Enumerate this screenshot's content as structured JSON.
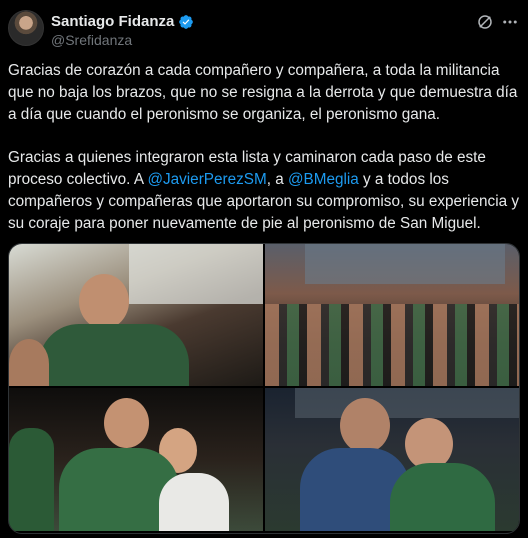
{
  "author": {
    "name": "Santiago Fidanza",
    "handle": "@Srefidanza"
  },
  "tweet": {
    "paragraph1": "Gracias de corazón a cada compañero y compañera, a toda la militancia que no baja los brazos, que no se resigna a la derrota y que demuestra día a día que cuando el peronismo se organiza, el peronismo gana.",
    "p2_a": "Gracias a quienes integraron esta lista y caminaron cada paso de este proceso colectivo. A ",
    "mention1": "@JavierPerezSM",
    "p2_b": ", a ",
    "mention2": "@BMeglia",
    "p2_c": " y a todos los compañeros y compañeras que aportaron su compromiso, su experiencia y su coraje para poner nuevamente de pie al peronismo de San Miguel."
  },
  "icons": {
    "verified": "verified-badge-icon",
    "grok": "grok-icon",
    "more": "more-options-icon"
  },
  "colors": {
    "background": "#000000",
    "text": "#e7e9ea",
    "secondary": "#71767b",
    "link": "#1d9bf0"
  }
}
